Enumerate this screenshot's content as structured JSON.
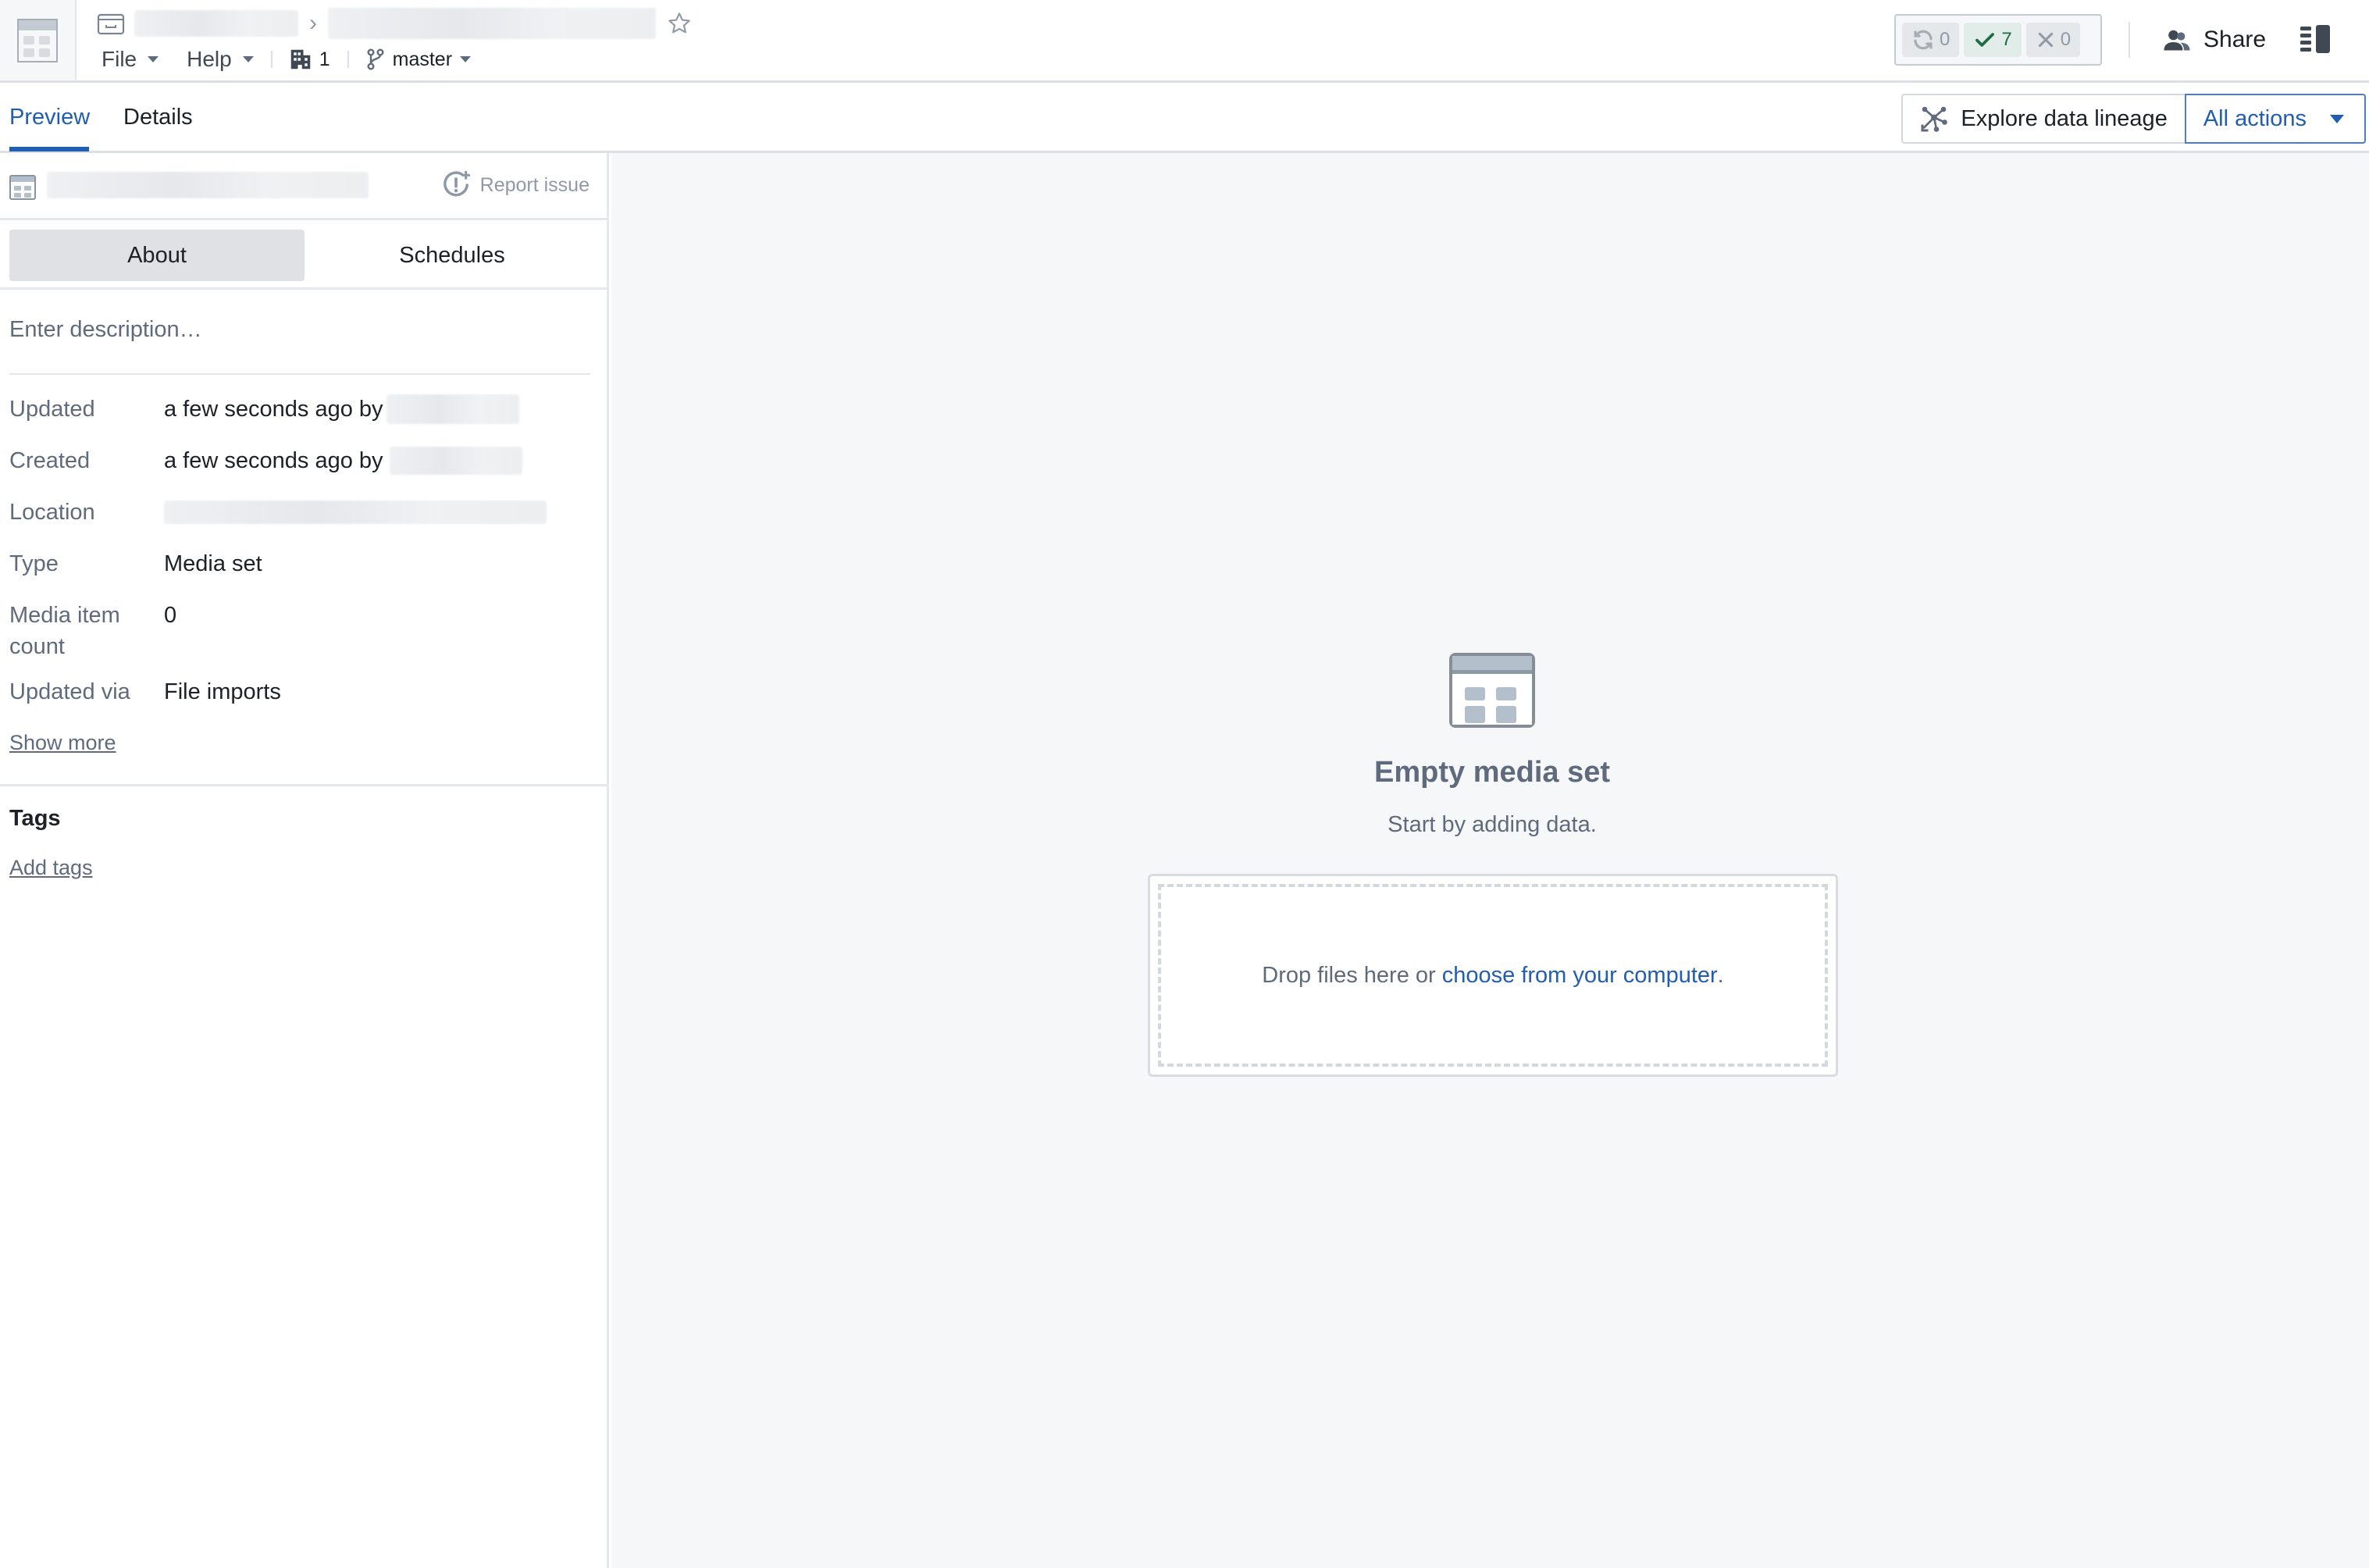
{
  "header": {
    "breadcrumb": {
      "separator": "›",
      "star_icon": "star-outline-icon"
    },
    "menu": {
      "file_label": "File",
      "help_label": "Help",
      "org_count": "1",
      "branch_label": "master"
    },
    "status": {
      "running_count": "0",
      "success_count": "7",
      "failed_count": "0"
    },
    "share_label": "Share"
  },
  "tabs": {
    "items": [
      {
        "label": "Preview",
        "active": true
      },
      {
        "label": "Details",
        "active": false
      }
    ],
    "explore_label": "Explore data lineage",
    "all_actions_label": "All actions"
  },
  "sidebar": {
    "report_issue_label": "Report issue",
    "segments": [
      {
        "label": "About",
        "active": true
      },
      {
        "label": "Schedules",
        "active": false
      }
    ],
    "description_placeholder": "Enter description…",
    "metadata": [
      {
        "label": "Updated",
        "value": "a few seconds ago by"
      },
      {
        "label": "Created",
        "value": "a few seconds ago by"
      },
      {
        "label": "Location",
        "value": ""
      },
      {
        "label": "Type",
        "value": "Media set"
      },
      {
        "label": "Media item count",
        "value": "0"
      },
      {
        "label": "Updated via",
        "value": "File imports"
      }
    ],
    "show_more_label": "Show more",
    "tags_title": "Tags",
    "add_tags_label": "Add tags"
  },
  "main": {
    "empty_title": "Empty media set",
    "empty_subtitle": "Start by adding data.",
    "drop_text": "Drop files here or",
    "choose_link": "choose from your computer",
    "drop_suffix": "."
  },
  "colors": {
    "accent": "#215db0",
    "success": "#1c6e42",
    "muted_text": "#5f6b7c",
    "main_bg": "#f6f7f9"
  }
}
